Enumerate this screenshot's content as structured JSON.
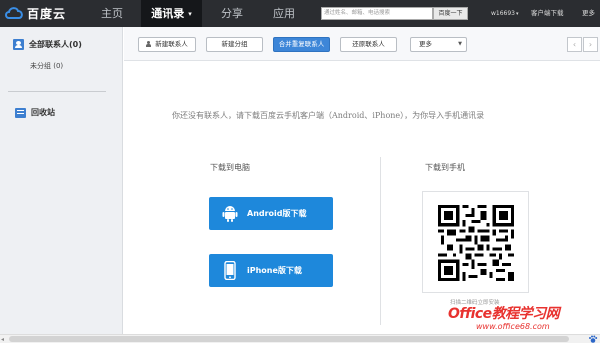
{
  "header": {
    "logo_text": "百度云",
    "nav": [
      {
        "label": "主页"
      },
      {
        "label": "通讯录"
      },
      {
        "label": "分享"
      },
      {
        "label": "应用"
      }
    ],
    "search_placeholder": "通过姓名、邮箱、电话搜索",
    "search_button": "百度一下",
    "username": "w16693",
    "client_download": "客户端下载",
    "more": "更多"
  },
  "sidebar": {
    "all_contacts": "全部联系人(0)",
    "ungrouped": "未分组 (0)",
    "recycle_bin": "回收站"
  },
  "toolbar": {
    "new_contact": "新建联系人",
    "new_group": "新建分组",
    "merge_duplicates": "合并重复联系人",
    "restore_contacts": "还原联系人",
    "more": "更多",
    "prev": "‹",
    "next": "›"
  },
  "content": {
    "notice": "你还没有联系人，请下载百度云手机客户端（Android、iPhone），为你导入手机通讯录",
    "pc_title": "下载到电脑",
    "phone_title": "下载到手机",
    "android_download": "Android版下载",
    "iphone_download": "iPhone版下载",
    "qr_caption": "扫描二维码立即安装"
  },
  "watermark": {
    "line1": "Office教程学习网",
    "line2": "www.office68.com"
  },
  "colors": {
    "topbar": "#2b2d31",
    "accent_blue": "#1e88db",
    "watermark_red": "#e8322f"
  }
}
